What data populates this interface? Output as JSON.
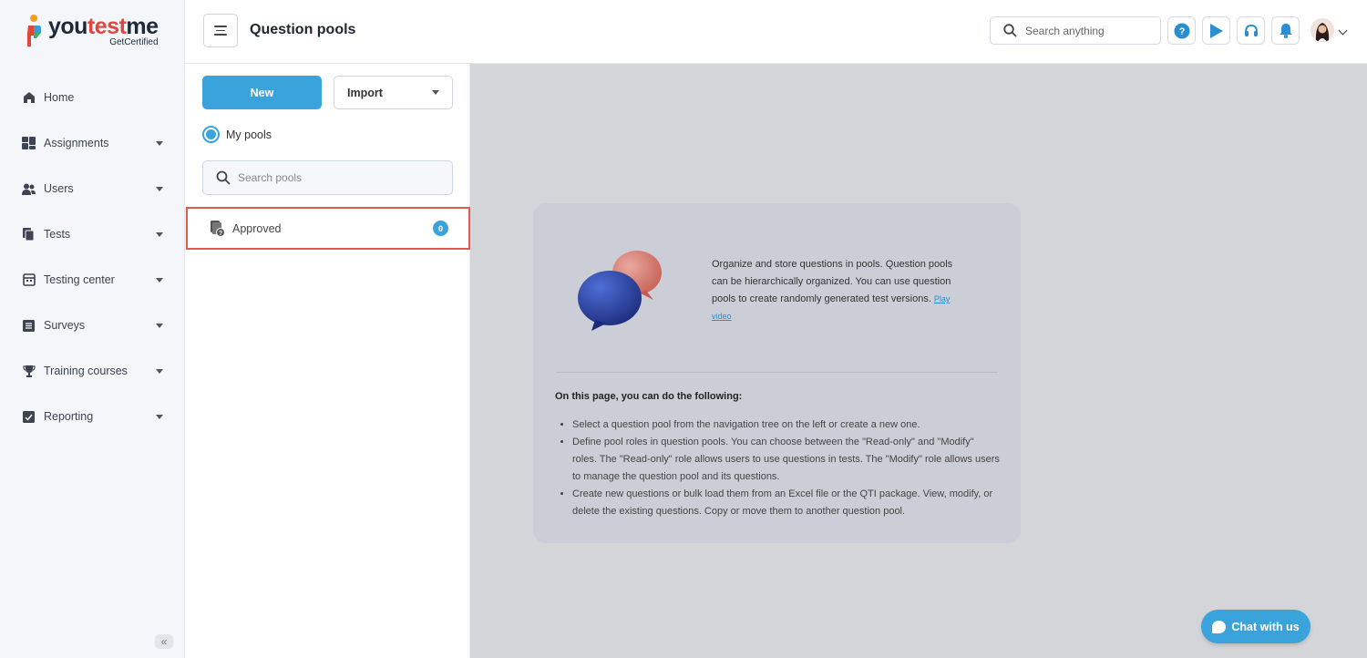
{
  "app": {
    "logo_word_a": "you",
    "logo_word_b": "test",
    "logo_word_c": "me",
    "logo_sub": "GetCertified"
  },
  "sidebar": {
    "items": [
      {
        "label": "Home",
        "icon": "home-icon",
        "has_caret": false
      },
      {
        "label": "Assignments",
        "icon": "assignments-icon",
        "has_caret": true
      },
      {
        "label": "Users",
        "icon": "users-icon",
        "has_caret": true
      },
      {
        "label": "Tests",
        "icon": "tests-icon",
        "has_caret": true
      },
      {
        "label": "Testing center",
        "icon": "testing-center-icon",
        "has_caret": true
      },
      {
        "label": "Surveys",
        "icon": "surveys-icon",
        "has_caret": true
      },
      {
        "label": "Training courses",
        "icon": "trophy-icon",
        "has_caret": true
      },
      {
        "label": "Reporting",
        "icon": "reporting-icon",
        "has_caret": true
      }
    ],
    "collapse_glyph": "«"
  },
  "header": {
    "title": "Question pools",
    "search_placeholder": "Search anything"
  },
  "pools": {
    "new_label": "New",
    "import_label": "Import",
    "filter_label": "My pools",
    "search_placeholder": "Search pools",
    "items": [
      {
        "label": "Approved",
        "count": "0"
      }
    ]
  },
  "info": {
    "intro": "Organize and store questions in pools. Question pools can be hierarchically organized. You can use question pools to create randomly generated test versions.",
    "play_video": "Play video",
    "do_title": "On this page, you can do the following:",
    "bullets": [
      "Select a question pool from the navigation tree on the left or create a new one.",
      "Define pool roles in question pools. You can choose between the \"Read-only\" and \"Modify\" roles. The \"Read-only\" role allows users to use questions in tests. The \"Modify\" role allows users to manage the question pool and its questions.",
      "Create new questions or bulk load them from an Excel file or the QTI package. View, modify, or delete the existing questions. Copy or move them to another question pool."
    ]
  },
  "chat": {
    "label": "Chat with us"
  },
  "colors": {
    "accent": "#3aa3dc",
    "highlight_border": "#e05a4f"
  }
}
